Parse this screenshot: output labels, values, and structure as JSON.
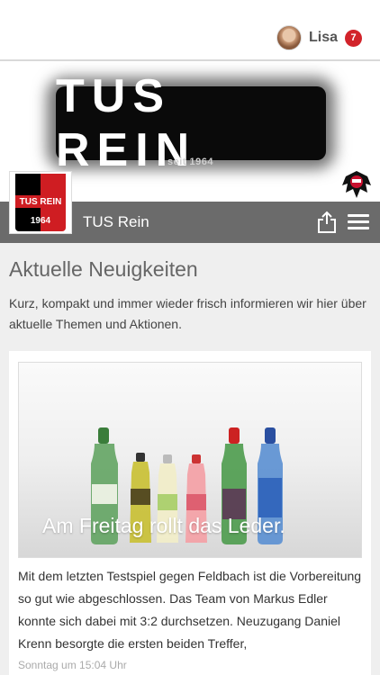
{
  "user": {
    "name": "Lisa",
    "notifications": "7"
  },
  "banner": {
    "logo_text": "TUS REIN",
    "logo_subtitle": "seit 1964"
  },
  "club": {
    "name": "TUS Rein",
    "crest_top": "TUS REIN",
    "crest_year": "1964"
  },
  "main": {
    "title": "Aktuelle Neuigkeiten",
    "intro": "Kurz, kompakt und immer wieder frisch informieren wir hier über aktuelle Themen und Aktionen."
  },
  "post": {
    "image_title": "Am Freitag rollt das Leder.",
    "excerpt": "Mit dem letzten Testspiel gegen Feldbach ist die Vorbereitung so gut wie abgeschlossen. Das Team von Markus Edler konnte sich dabei mit 3:2 durchsetzen. Neuzugang Daniel Krenn besorgte die ersten beiden Treffer,",
    "timestamp": "Sonntag um 15:04 Uhr"
  },
  "colors": {
    "accent_red": "#d2232a",
    "club_bar": "#6b6b6b",
    "content_bg": "#efefef"
  }
}
